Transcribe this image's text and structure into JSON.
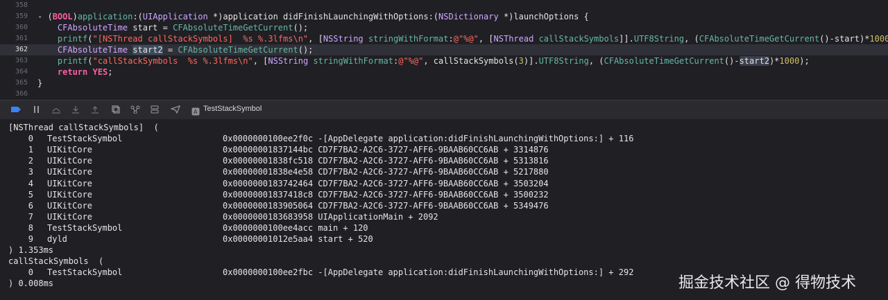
{
  "editor": {
    "current_line": "362",
    "lines": [
      {
        "num": "358",
        "tokens": []
      },
      {
        "num": "359",
        "tokens": [
          {
            "t": "plain",
            "v": "- ("
          },
          {
            "t": "kw",
            "v": "BOOL"
          },
          {
            "t": "plain",
            "v": ")"
          },
          {
            "t": "fn",
            "v": "application"
          },
          {
            "t": "plain",
            "v": ":("
          },
          {
            "t": "type",
            "v": "UIApplication"
          },
          {
            "t": "plain",
            "v": " *)application didFinishLaunchingWithOptions:("
          },
          {
            "t": "type",
            "v": "NSDictionary"
          },
          {
            "t": "plain",
            "v": " *)launchOptions {"
          }
        ]
      },
      {
        "num": "360",
        "tokens": [
          {
            "t": "plain",
            "v": "    "
          },
          {
            "t": "type",
            "v": "CFAbsoluteTime"
          },
          {
            "t": "plain",
            "v": " start = "
          },
          {
            "t": "fn",
            "v": "CFAbsoluteTimeGetCurrent"
          },
          {
            "t": "plain",
            "v": "();"
          }
        ]
      },
      {
        "num": "361",
        "tokens": [
          {
            "t": "plain",
            "v": "    "
          },
          {
            "t": "fn",
            "v": "printf"
          },
          {
            "t": "plain",
            "v": "("
          },
          {
            "t": "str",
            "v": "\"[NSThread callStackSymbols]  %s %.3lfms\\n\""
          },
          {
            "t": "plain",
            "v": ", ["
          },
          {
            "t": "type",
            "v": "NSString"
          },
          {
            "t": "plain",
            "v": " "
          },
          {
            "t": "fn",
            "v": "stringWithFormat"
          },
          {
            "t": "plain",
            "v": ":"
          },
          {
            "t": "str",
            "v": "@\"%@\""
          },
          {
            "t": "plain",
            "v": ", ["
          },
          {
            "t": "type",
            "v": "NSThread"
          },
          {
            "t": "plain",
            "v": " "
          },
          {
            "t": "fn",
            "v": "callStackSymbols"
          },
          {
            "t": "plain",
            "v": "]]."
          },
          {
            "t": "fn",
            "v": "UTF8String"
          },
          {
            "t": "plain",
            "v": ", ("
          },
          {
            "t": "fn",
            "v": "CFAbsoluteTimeGetCurrent"
          },
          {
            "t": "plain",
            "v": "()-start)*"
          },
          {
            "t": "num",
            "v": "1000"
          },
          {
            "t": "plain",
            "v": ");"
          }
        ]
      },
      {
        "num": "362",
        "tokens": [
          {
            "t": "plain",
            "v": "    "
          },
          {
            "t": "type",
            "v": "CFAbsoluteTime"
          },
          {
            "t": "plain",
            "v": " "
          },
          {
            "t": "hl",
            "v": "start2"
          },
          {
            "t": "plain",
            "v": " = "
          },
          {
            "t": "fn",
            "v": "CFAbsoluteTimeGetCurrent"
          },
          {
            "t": "plain",
            "v": "();"
          }
        ]
      },
      {
        "num": "363",
        "tokens": [
          {
            "t": "plain",
            "v": "    "
          },
          {
            "t": "fn",
            "v": "printf"
          },
          {
            "t": "plain",
            "v": "("
          },
          {
            "t": "str",
            "v": "\"callStackSymbols  %s %.3lfms\\n\""
          },
          {
            "t": "plain",
            "v": ", ["
          },
          {
            "t": "type",
            "v": "NSString"
          },
          {
            "t": "plain",
            "v": " "
          },
          {
            "t": "fn",
            "v": "stringWithFormat"
          },
          {
            "t": "plain",
            "v": ":"
          },
          {
            "t": "str",
            "v": "@\"%@\""
          },
          {
            "t": "plain",
            "v": ", callStackSymbols("
          },
          {
            "t": "num",
            "v": "3"
          },
          {
            "t": "plain",
            "v": ")]."
          },
          {
            "t": "fn",
            "v": "UTF8String"
          },
          {
            "t": "plain",
            "v": ", ("
          },
          {
            "t": "fn",
            "v": "CFAbsoluteTimeGetCurrent"
          },
          {
            "t": "plain",
            "v": "()-"
          },
          {
            "t": "hl2",
            "v": "start2"
          },
          {
            "t": "plain",
            "v": ")*"
          },
          {
            "t": "num",
            "v": "1000"
          },
          {
            "t": "plain",
            "v": ");"
          }
        ]
      },
      {
        "num": "364",
        "tokens": [
          {
            "t": "plain",
            "v": "    "
          },
          {
            "t": "kw",
            "v": "return"
          },
          {
            "t": "plain",
            "v": " "
          },
          {
            "t": "kw",
            "v": "YES"
          },
          {
            "t": "plain",
            "v": ";"
          }
        ]
      },
      {
        "num": "365",
        "tokens": [
          {
            "t": "plain",
            "v": "}"
          }
        ]
      },
      {
        "num": "366",
        "tokens": []
      }
    ]
  },
  "debug_bar": {
    "target": "TestStackSymbol",
    "icons": [
      "breakpoints-toggle-icon",
      "pause-icon",
      "step-over-icon",
      "step-into-icon",
      "step-out-icon",
      "view-hierarchy-icon",
      "memory-graph-icon",
      "environment-overrides-icon",
      "location-icon"
    ]
  },
  "console": {
    "header1": "[NSThread callStackSymbols]  (",
    "frames1": [
      {
        "idx": "0",
        "module": "TestStackSymbol",
        "rest": "0x0000000100ee2f0c -[AppDelegate application:didFinishLaunchingWithOptions:] + 116"
      },
      {
        "idx": "1",
        "module": "UIKitCore",
        "rest": "0x00000001837144bc CD7F7BA2-A2C6-3727-AFF6-9BAAB60CC6AB + 3314876"
      },
      {
        "idx": "2",
        "module": "UIKitCore",
        "rest": "0x00000001838fc518 CD7F7BA2-A2C6-3727-AFF6-9BAAB60CC6AB + 5313816"
      },
      {
        "idx": "3",
        "module": "UIKitCore",
        "rest": "0x00000001838e4e58 CD7F7BA2-A2C6-3727-AFF6-9BAAB60CC6AB + 5217880"
      },
      {
        "idx": "4",
        "module": "UIKitCore",
        "rest": "0x0000000183742464 CD7F7BA2-A2C6-3727-AFF6-9BAAB60CC6AB + 3503204"
      },
      {
        "idx": "5",
        "module": "UIKitCore",
        "rest": "0x00000001837418c8 CD7F7BA2-A2C6-3727-AFF6-9BAAB60CC6AB + 3500232"
      },
      {
        "idx": "6",
        "module": "UIKitCore",
        "rest": "0x0000000183905064 CD7F7BA2-A2C6-3727-AFF6-9BAAB60CC6AB + 5349476"
      },
      {
        "idx": "7",
        "module": "UIKitCore",
        "rest": "0x0000000183683958 UIApplicationMain + 2092"
      },
      {
        "idx": "8",
        "module": "TestStackSymbol",
        "rest": "0x0000000100ee4acc main + 120"
      },
      {
        "idx": "9",
        "module": "dyld",
        "rest": "0x00000001012e5aa4 start + 520"
      }
    ],
    "footer1": ") 1.353ms",
    "header2": "callStackSymbols  (",
    "frames2": [
      {
        "idx": "0",
        "module": "TestStackSymbol",
        "rest": "0x0000000100ee2fbc -[AppDelegate application:didFinishLaunchingWithOptions:] + 292"
      }
    ],
    "footer2": ") 0.008ms"
  },
  "watermark": "掘金技术社区 @ 得物技术"
}
